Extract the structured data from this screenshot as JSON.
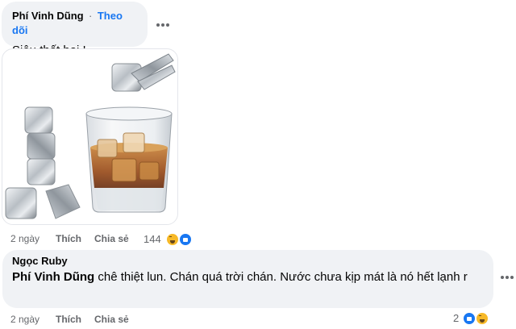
{
  "comment1": {
    "author": "Phí Vinh Dũng",
    "separator": "·",
    "follow_label": "Theo dõi",
    "text": "Siêu thất bại !",
    "actions": {
      "time": "2 ngày",
      "like_label": "Thích",
      "reply_label": "Chia sẻ"
    },
    "reaction_count": "144",
    "reactions": [
      "haha",
      "like"
    ],
    "image_icon": "ice-cubes-whiskey-glass-image"
  },
  "comment2": {
    "author": "Ngọc Ruby",
    "mention": "Phí Vinh Dũng",
    "text": " chê thiệt lun. Chán quá trời chán. Nước chưa kịp mát là nó hết lạnh r",
    "actions": {
      "time": "2 ngày",
      "like_label": "Thích",
      "reply_label": "Chia sẻ"
    },
    "reaction_count": "2",
    "reactions": [
      "like",
      "haha"
    ]
  },
  "colors": {
    "bubble": "#f0f2f5",
    "link": "#1877f2",
    "meta": "#65676b",
    "like": "#1877f2",
    "haha": "#f7b928"
  },
  "icons": [
    "more-options-icon",
    "like-reaction-icon",
    "haha-reaction-icon"
  ]
}
